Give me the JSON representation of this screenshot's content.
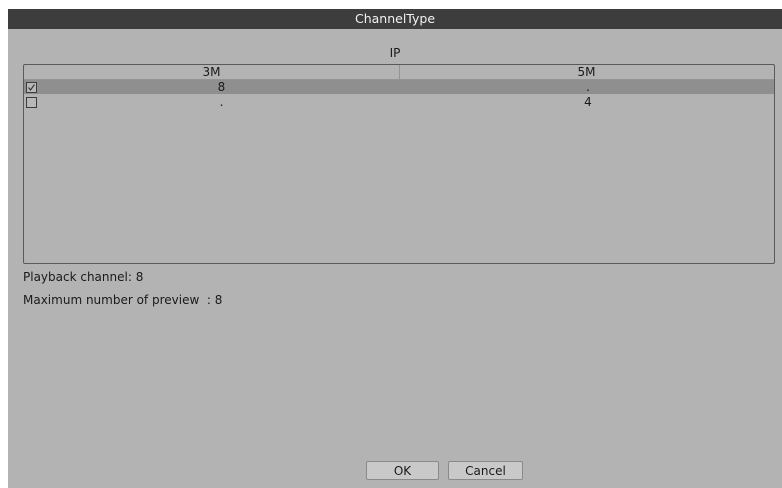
{
  "window": {
    "title": "ChannelType"
  },
  "group_label": "IP",
  "table": {
    "columns": [
      "3M",
      "5M"
    ],
    "rows": [
      {
        "checked": true,
        "values": [
          "8",
          "."
        ],
        "selected": true
      },
      {
        "checked": false,
        "values": [
          ".",
          "4"
        ],
        "selected": false
      }
    ]
  },
  "info": {
    "playback": "Playback channel: 8",
    "preview": "Maximum number of preview  : 8"
  },
  "buttons": {
    "ok": "OK",
    "cancel": "Cancel"
  },
  "colors": {
    "background": "#b3b3b3",
    "titlebar": "#3d3d3d",
    "selected_row": "#8f8f8f",
    "header_line": "#5ea3d6"
  }
}
